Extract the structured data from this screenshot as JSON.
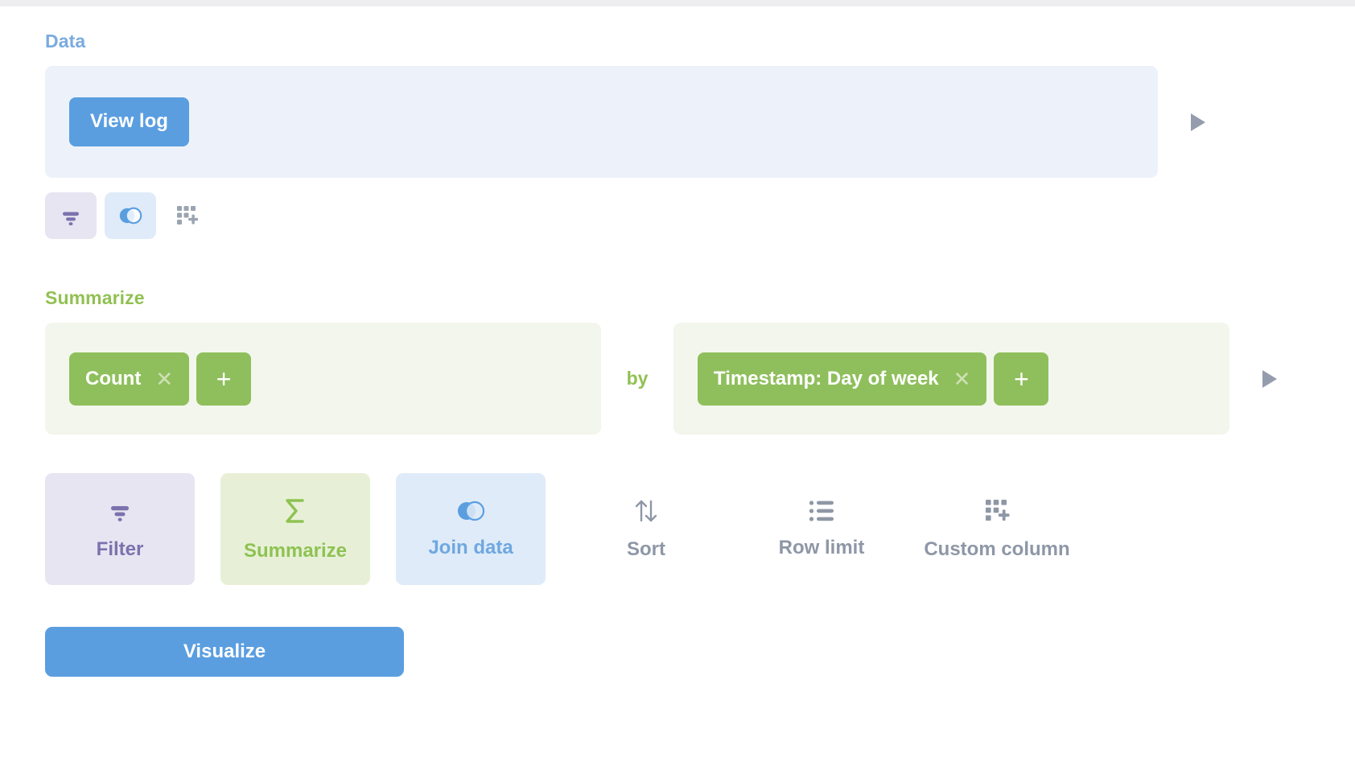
{
  "theme": {
    "brand_blue": "#5a9ee0",
    "data_accent": "#7aabde",
    "summarize_accent": "#91c152",
    "pill_green": "#8fbf5c",
    "filter_purple": "#7c72ad",
    "muted_gray": "#8e97a6",
    "data_panel_bg": "#edf2fa",
    "summarize_panel_bg": "#f3f6ed",
    "filter_chip_bg": "#e6e5f1",
    "join_chip_bg": "#dfebf8",
    "summarize_card_bg": "#e7f0d7"
  },
  "data_step": {
    "title": "Data",
    "source_button_label": "View log",
    "run_arrow_icon": "play-icon",
    "quick_actions": [
      {
        "name": "filter",
        "icon": "filter-icon",
        "style": "purple"
      },
      {
        "name": "join-data",
        "icon": "join-icon",
        "style": "blue"
      },
      {
        "name": "custom-column",
        "icon": "custom-column-icon",
        "style": "plain"
      }
    ]
  },
  "summarize_step": {
    "title": "Summarize",
    "connector_label": "by",
    "run_arrow_icon": "play-icon",
    "aggregations": [
      {
        "label": "Count",
        "remove_icon": "close-icon"
      }
    ],
    "add_aggregation_label": "+",
    "breakouts": [
      {
        "label": "Timestamp: Day of week",
        "remove_icon": "close-icon"
      }
    ],
    "add_breakout_label": "+"
  },
  "action_buttons": [
    {
      "label": "Filter",
      "icon": "filter-icon",
      "style": "purple"
    },
    {
      "label": "Summarize",
      "icon": "sigma-icon",
      "style": "green"
    },
    {
      "label": "Join data",
      "icon": "join-icon",
      "style": "blue"
    },
    {
      "label": "Sort",
      "icon": "sort-icon",
      "style": "plain"
    },
    {
      "label": "Row limit",
      "icon": "row-limit-icon",
      "style": "plain"
    },
    {
      "label": "Custom column",
      "icon": "custom-column-icon",
      "style": "plain"
    }
  ],
  "footer": {
    "visualize_label": "Visualize"
  }
}
